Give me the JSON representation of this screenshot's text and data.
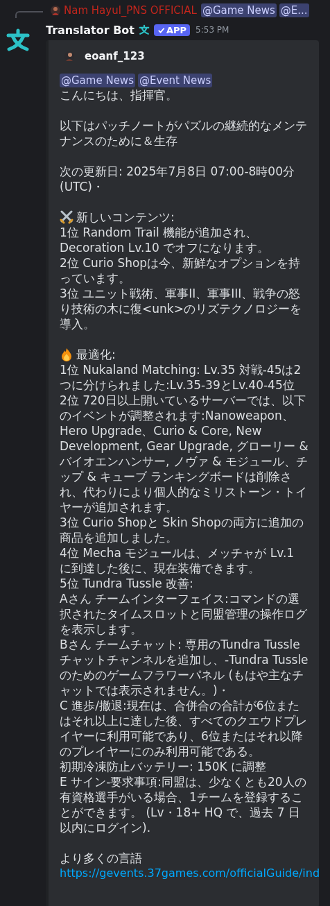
{
  "reply": {
    "author": "Nam Hayul_PNS OFFICIAL",
    "mentions": [
      "@Game News",
      "@E..."
    ]
  },
  "message": {
    "author": "Translator Bot",
    "badge": "APP",
    "verified": true,
    "time": "5:53 PM"
  },
  "embed": {
    "author": "eoanf_123",
    "mentions": [
      "@Game News",
      "@Event News"
    ],
    "blocks": [
      {
        "kind": "text",
        "lines": [
          "こんにちは、指揮官。"
        ]
      },
      {
        "kind": "text",
        "lines": [
          "以下はパッチノートがパズルの継続的なメンテナンスのために＆生存"
        ]
      },
      {
        "kind": "text",
        "lines": [
          "次の更新日: 2025年7月8日 07:00-8時00分 (UTC)・"
        ]
      },
      {
        "kind": "swords",
        "heading": "新しいコンテンツ:",
        "lines": [
          "1位 Random Trail 機能が追加され、Decoration Lv.10 でオフになります。",
          "2位 Curio Shopは今、新鮮なオプションを持っています。",
          "3位 ユニット戦術、軍事II、軍事III、戦争の怒り技術の木に復<unk>のリズテクノロジーを導入。"
        ]
      },
      {
        "kind": "fire",
        "heading": "最適化:",
        "lines": [
          "1位 Nukaland Matching: Lv.35 対戦-45は2つに分けられました:Lv.35-39とLv.40-45位",
          "2位 720日以上開いているサーバーでは、以下のイベントが調整されます:Nanoweapon、Hero Upgrade、Curio & Core, New Development, Gear Upgrade, グローリー & バイオエンハンサー, ノヴァ & モジュール、チップ & キューブ ランキングボードは削除され、代わりにより個人的なミリストーン・トイヤーが追加されます。",
          "3位 Curio Shopと Skin Shopの両方に追加の商品を追加しました。",
          "4位 Mecha モジュールは、メッチャが Lv.1 に到達した後に、現在装備できます。",
          "5位 Tundra Tussle 改善:",
          "Aさん チームインターフェイス:コマンドの選択されたタイムスロットと同盟管理の操作ログを表示します。",
          "Bさん チームチャット: 専用のTundra Tussleチャットチャンネルを追加し、-Tundra Tussleのためのゲームフラワーパネル (もはや主なチャットでは表示されません。)・",
          "C 進歩/撤退:現在は、合併合の合計が6位またはそれ以上に達した後、すべてのクエウドプレイヤーに利用可能であり、6位またはそれ以降のプレイヤーにのみ利用可能である。",
          "初期冷凍防止バッテリー: 150K に調整",
          "E サイン-要求事項:同盟は、少なくとも20人の有資格選手がいる場合、1チームを登録することができます。 (Lv・18+ HQ で、過去 7 日以内にログイン)."
        ]
      },
      {
        "kind": "link",
        "lines": [
          "より多くの言語"
        ],
        "url": "https://gevents.37games.com/officialGuide/ind"
      }
    ]
  }
}
